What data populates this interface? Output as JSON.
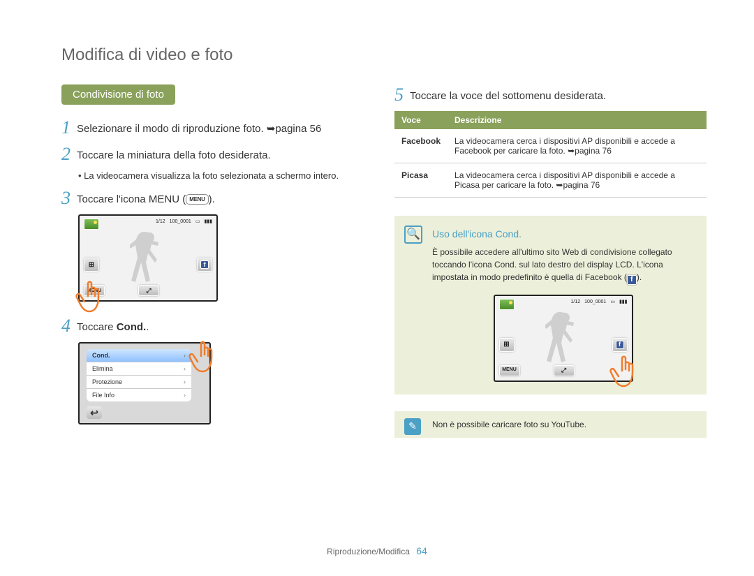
{
  "page": {
    "title": "Modifica di video e foto",
    "footer_section": "Riproduzione/Modifica",
    "footer_page": "64"
  },
  "left": {
    "pill": "Condivisione di foto",
    "steps": {
      "s1": {
        "num": "1",
        "text": "Selezionare il modo di riproduzione foto. ➥pagina 56"
      },
      "s2": {
        "num": "2",
        "text": "Toccare la miniatura della foto desiderata."
      },
      "s2_sub": "La videocamera visualizza la foto selezionata a schermo intero.",
      "s3": {
        "num": "3",
        "text_prefix": "Toccare l'icona MENU (",
        "text_suffix": ")."
      },
      "s4": {
        "num": "4",
        "text_prefix": "Toccare ",
        "bold": "Cond.",
        "text_suffix": "."
      }
    },
    "lcd1": {
      "counter": "1/12",
      "file": "100_0001",
      "menu_label": "MENU"
    },
    "menu_items": {
      "cond": "Cond.",
      "elimina": "Elimina",
      "protezione": "Protezione",
      "fileinfo": "File Info"
    }
  },
  "right": {
    "step5": {
      "num": "5",
      "text": "Toccare la voce del sottomenu desiderata."
    },
    "table": {
      "h1": "Voce",
      "h2": "Descrizione",
      "rows": [
        {
          "k": "Facebook",
          "v": "La videocamera cerca i dispositivi AP disponibili e accede a Facebook per caricare la foto. ➥pagina 76"
        },
        {
          "k": "Picasa",
          "v": "La videocamera cerca i dispositivi AP disponibili e accede a Picasa per caricare la foto. ➥pagina 76"
        }
      ]
    },
    "tip": {
      "title": "Uso dell'icona Cond.",
      "body_prefix": "È possibile accedere all'ultimo sito Web di condivisione collegato toccando l'icona Cond. sul lato destro del display LCD. L'icona impostata in modo predefinito è quella di Facebook (",
      "body_suffix": ")."
    },
    "tip_lcd": {
      "counter": "1/12",
      "file": "100_0001",
      "menu_label": "MENU"
    },
    "note": "Non è possibile caricare foto su YouTube."
  },
  "icons": {
    "menu_chip": "MENU"
  }
}
